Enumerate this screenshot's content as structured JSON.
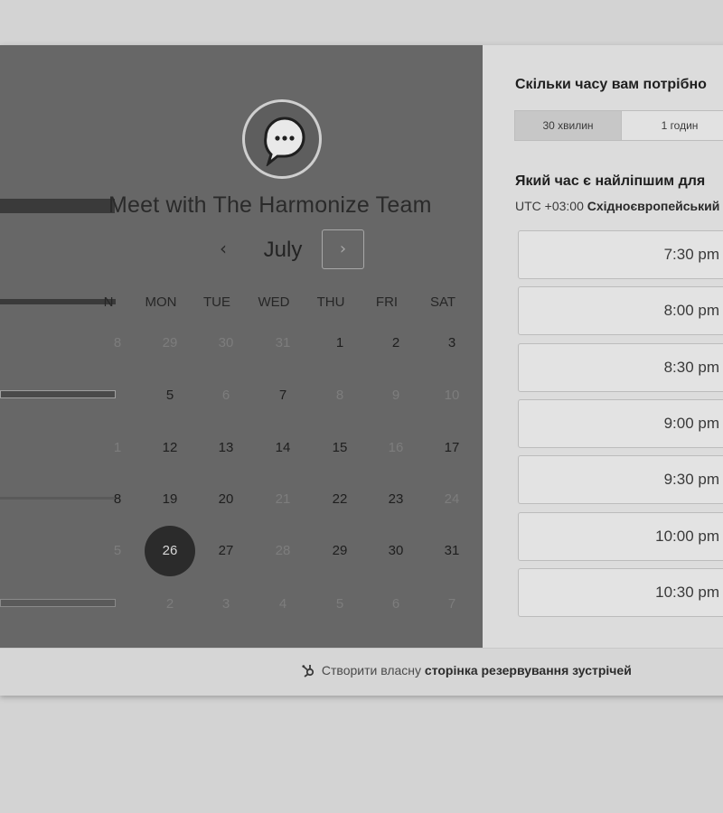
{
  "header": {
    "title": "Meet with The Harmonize Team"
  },
  "calendar": {
    "month": "July",
    "days_of_week": [
      "N",
      "MON",
      "TUE",
      "WED",
      "THU",
      "FRI",
      "SAT"
    ],
    "weeks": [
      [
        {
          "d": "8",
          "s": "inactive"
        },
        {
          "d": "29",
          "s": "inactive"
        },
        {
          "d": "30",
          "s": "inactive"
        },
        {
          "d": "31",
          "s": "inactive"
        },
        {
          "d": "1",
          "s": "active"
        },
        {
          "d": "2",
          "s": "active"
        },
        {
          "d": "3",
          "s": "active"
        }
      ],
      [
        {
          "d": "",
          "s": "inactive"
        },
        {
          "d": "5",
          "s": "active"
        },
        {
          "d": "6",
          "s": "inactive"
        },
        {
          "d": "7",
          "s": "active"
        },
        {
          "d": "8",
          "s": "inactive"
        },
        {
          "d": "9",
          "s": "inactive"
        },
        {
          "d": "10",
          "s": "inactive"
        }
      ],
      [
        {
          "d": "1",
          "s": "inactive"
        },
        {
          "d": "12",
          "s": "active"
        },
        {
          "d": "13",
          "s": "active"
        },
        {
          "d": "14",
          "s": "active"
        },
        {
          "d": "15",
          "s": "active"
        },
        {
          "d": "16",
          "s": "inactive"
        },
        {
          "d": "17",
          "s": "active"
        }
      ],
      [
        {
          "d": "8",
          "s": "active"
        },
        {
          "d": "19",
          "s": "active"
        },
        {
          "d": "20",
          "s": "active"
        },
        {
          "d": "21",
          "s": "inactive"
        },
        {
          "d": "22",
          "s": "active"
        },
        {
          "d": "23",
          "s": "active"
        },
        {
          "d": "24",
          "s": "inactive"
        }
      ],
      [
        {
          "d": "5",
          "s": "inactive"
        },
        {
          "d": "26",
          "s": "selected"
        },
        {
          "d": "27",
          "s": "active"
        },
        {
          "d": "28",
          "s": "inactive"
        },
        {
          "d": "29",
          "s": "active"
        },
        {
          "d": "30",
          "s": "active"
        },
        {
          "d": "31",
          "s": "active"
        }
      ],
      [
        {
          "d": "",
          "s": "inactive"
        },
        {
          "d": "2",
          "s": "inactive"
        },
        {
          "d": "3",
          "s": "inactive"
        },
        {
          "d": "4",
          "s": "inactive"
        },
        {
          "d": "5",
          "s": "inactive"
        },
        {
          "d": "6",
          "s": "inactive"
        },
        {
          "d": "7",
          "s": "inactive"
        }
      ]
    ]
  },
  "booking": {
    "duration_question": "Скільки часу вам потрібно",
    "durations": [
      "30 хвилин",
      "1 годин"
    ],
    "selected_duration": "30 хвилин",
    "time_question": "Який час є найліпшим для",
    "timezone_prefix": "UTC +03:00",
    "timezone_name": "Східноєвропейський",
    "slots": [
      "7:30 pm",
      "8:00 pm",
      "8:30 pm",
      "9:00 pm",
      "9:30 pm",
      "10:00 pm",
      "10:30 pm"
    ]
  },
  "footer": {
    "text_plain": "Створити власну",
    "text_bold": "сторінка резервування зустрічей"
  },
  "colors": {
    "left_panel": "#676767",
    "right_panel": "#dcdcdc",
    "selected_day": "#2b2b2b"
  },
  "icons": {
    "avatar": "chat-bubble-icon",
    "prev": "chevron-left-icon",
    "next": "chevron-right-icon",
    "footer": "hubspot-sprocket-icon"
  }
}
